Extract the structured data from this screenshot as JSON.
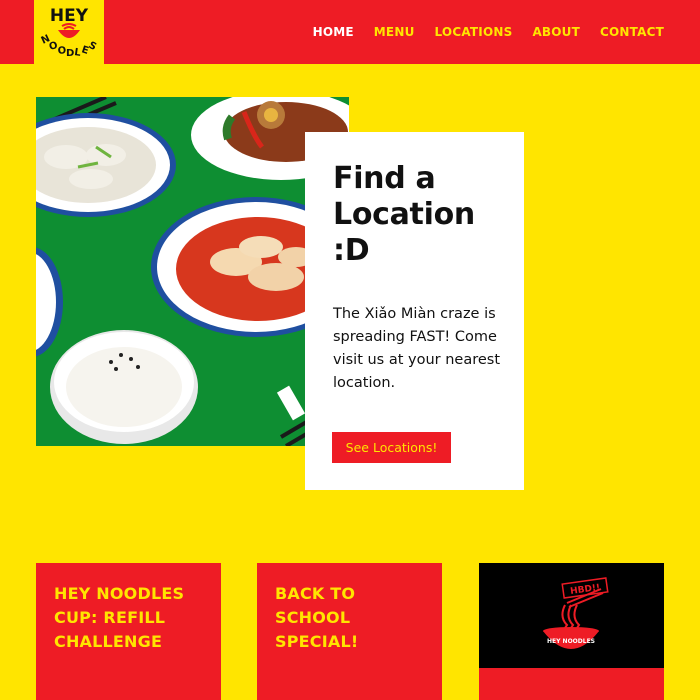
{
  "brand": {
    "logo_text_top": "HEY",
    "logo_text_bottom": "NOODLES",
    "colors": {
      "red": "#EE1C25",
      "yellow": "#FFE500",
      "white": "#FFFFFF",
      "black": "#000000"
    }
  },
  "nav": {
    "items": [
      {
        "label": "HOME",
        "active": true
      },
      {
        "label": "MENU",
        "active": false
      },
      {
        "label": "LOCATIONS",
        "active": false
      },
      {
        "label": "ABOUT",
        "active": false
      },
      {
        "label": "CONTACT",
        "active": false
      }
    ]
  },
  "hero": {
    "image_alt": "noodle-dishes-photo",
    "card": {
      "title_line1": "Find a",
      "title_line2": "Location",
      "title_line3": ":D",
      "body": "The Xiǎo Miàn craze is spreading FAST! Come visit us at your nearest location.",
      "button_label": "See Locations!"
    }
  },
  "promos": [
    {
      "title_line1": "HEY NOODLES",
      "title_line2": "CUP: REFILL",
      "title_line3": "CHALLENGE"
    },
    {
      "title_line1": "BACK TO",
      "title_line2": "SCHOOL",
      "title_line3": "SPECIAL!"
    }
  ],
  "promo_image": {
    "sign_text": "HBD!!",
    "bowl_text": "HEY NOODLES"
  }
}
